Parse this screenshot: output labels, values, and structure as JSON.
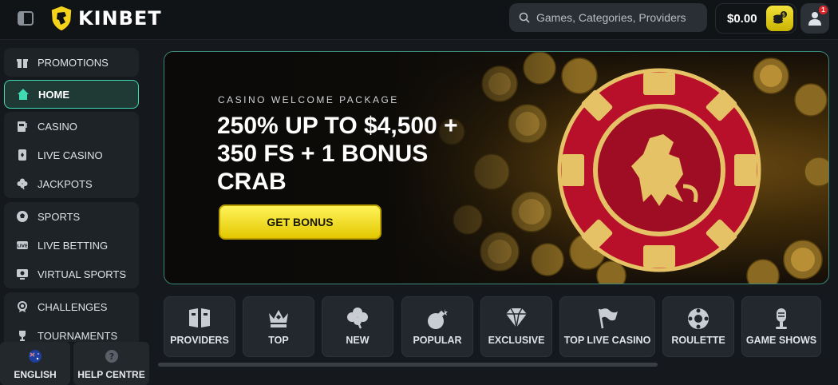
{
  "header": {
    "brand": "KINBET",
    "search_placeholder": "Games, Categories, Providers",
    "balance": "$0.00",
    "notification_count": "1"
  },
  "sidebar": {
    "groups": [
      {
        "items": [
          {
            "label": "PROMOTIONS",
            "icon": "gift-icon"
          }
        ]
      },
      {
        "items": [
          {
            "label": "HOME",
            "icon": "home-icon",
            "active": true
          }
        ]
      },
      {
        "items": [
          {
            "label": "CASINO",
            "icon": "slot-machine-icon"
          },
          {
            "label": "LIVE CASINO",
            "icon": "card-icon"
          },
          {
            "label": "JACKPOTS",
            "icon": "clover-icon"
          }
        ]
      },
      {
        "items": [
          {
            "label": "SPORTS",
            "icon": "soccer-ball-icon"
          },
          {
            "label": "LIVE BETTING",
            "icon": "live-icon"
          },
          {
            "label": "VIRTUAL SPORTS",
            "icon": "virtual-icon"
          }
        ]
      },
      {
        "items": [
          {
            "label": "CHALLENGES",
            "icon": "challenge-icon"
          },
          {
            "label": "TOURNAMENTS",
            "icon": "trophy-icon"
          }
        ]
      }
    ],
    "bottom": {
      "language": "ENGLISH",
      "help": "HELP CENTRE"
    }
  },
  "banner": {
    "kicker": "CASINO WELCOME PACKAGE",
    "headline": "250% UP TO $4,500 + 350 FS + 1 BONUS CRAB",
    "cta": "GET BONUS"
  },
  "categories": [
    {
      "label": "PROVIDERS",
      "icon": "book-icon"
    },
    {
      "label": "TOP",
      "icon": "crown-icon"
    },
    {
      "label": "NEW",
      "icon": "clover-icon"
    },
    {
      "label": "POPULAR",
      "icon": "bomb-icon"
    },
    {
      "label": "EXCLUSIVE",
      "icon": "diamond-icon"
    },
    {
      "label": "TOP LIVE CASINO",
      "icon": "flag-icon"
    },
    {
      "label": "ROULETTE",
      "icon": "roulette-icon"
    },
    {
      "label": "GAME SHOWS",
      "icon": "microphone-icon"
    }
  ],
  "colors": {
    "accent": "#3fd9b2",
    "cta": "#f2e23a",
    "background": "#15181c"
  }
}
